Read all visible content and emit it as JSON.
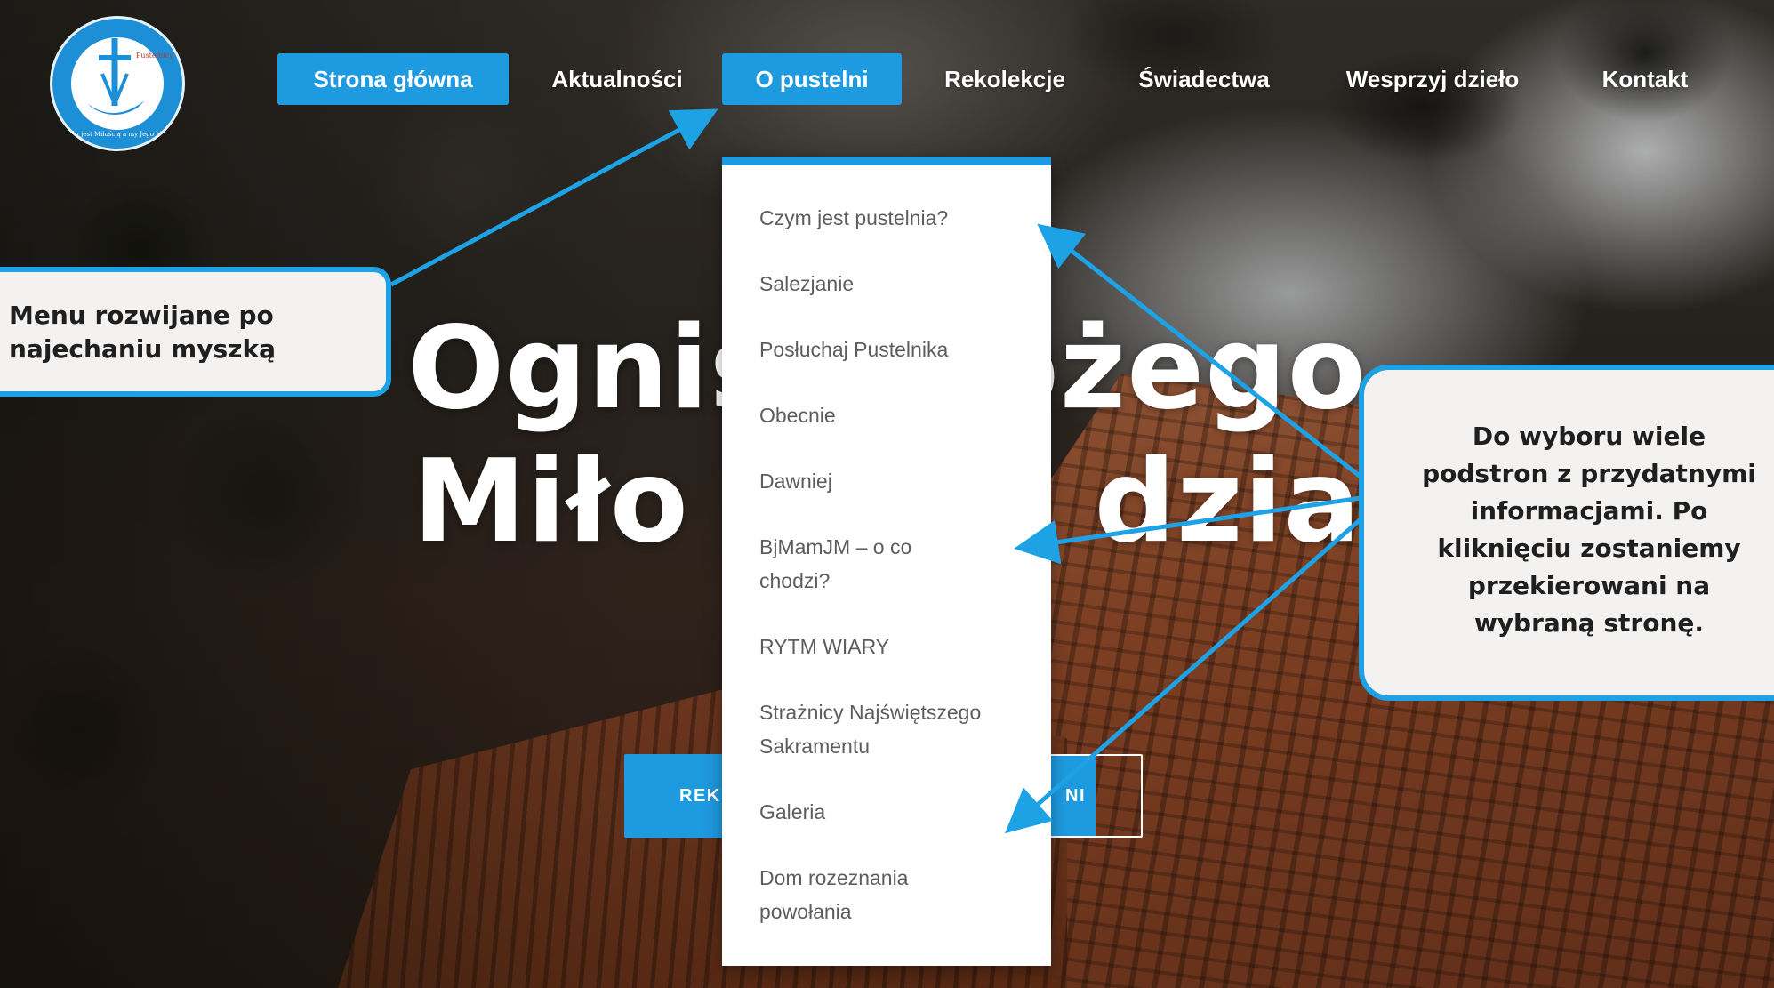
{
  "nav": {
    "items": [
      {
        "label": "Strona główna",
        "active": true
      },
      {
        "label": "Aktualności",
        "active": false
      },
      {
        "label": "O pustelni",
        "active": true
      },
      {
        "label": "Rekolekcje",
        "active": false
      },
      {
        "label": "Świadectwa",
        "active": false
      },
      {
        "label": "Wesprzyj dzieło",
        "active": false
      },
      {
        "label": "Kontakt",
        "active": false
      }
    ]
  },
  "logo": {
    "top_text": "Pustelnicy Chrystusa",
    "ring_text": "Bóg jest Miłością a my Jego Miłosierdziem"
  },
  "dropdown": {
    "items": [
      {
        "line1": "Czym jest pustelnia?",
        "line2": ""
      },
      {
        "line1": "Salezjanie",
        "line2": ""
      },
      {
        "line1": "Posłuchaj Pustelnika",
        "line2": ""
      },
      {
        "line1": "Obecnie",
        "line2": ""
      },
      {
        "line1": "Dawniej",
        "line2": ""
      },
      {
        "line1": "BjMamJM – o co",
        "line2": "chodzi?"
      },
      {
        "line1": "RYTM WIARY",
        "line2": ""
      },
      {
        "line1": "Strażnicy Najświętszego",
        "line2": "Sakramentu"
      },
      {
        "line1": "Galeria",
        "line2": ""
      },
      {
        "line1": "Dom rozeznania",
        "line2": "powołania"
      }
    ]
  },
  "hero": {
    "title_line1": "Ognis     ożego",
    "title_line2": "Miło          dzia",
    "button_primary": "REK",
    "button_secondary": "NI"
  },
  "callouts": {
    "left_line1": "Menu rozwijane po",
    "left_line2": "najechaniu myszką",
    "right_lines": [
      "Do wyboru wiele",
      "podstron z przydatnymi",
      "informacjami. Po",
      "kliknięciu zostaniemy",
      "przekierowani na",
      "wybraną stronę."
    ]
  },
  "colors": {
    "accent": "#1e9ae0",
    "callout_border": "#1ea2e6",
    "callout_bg": "#f3f2f1",
    "dropdown_text": "#5d5d5d"
  }
}
